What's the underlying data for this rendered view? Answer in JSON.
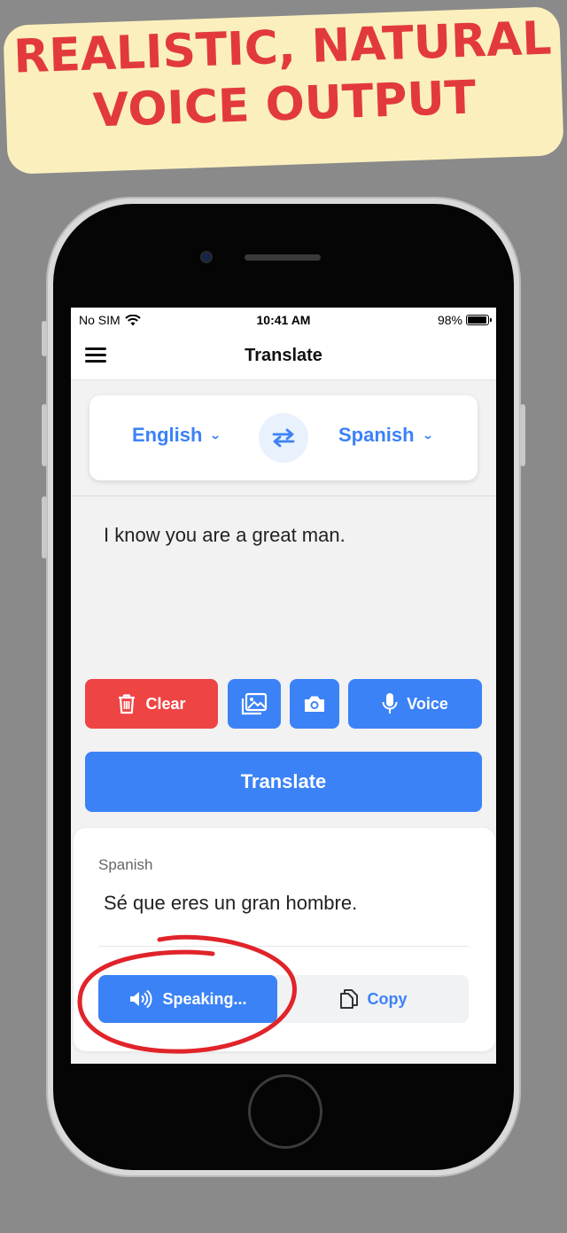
{
  "banner": {
    "line1": "Realistic, Natural",
    "line2": "Voice Output",
    "text_color": "#e23a3a",
    "background": "#fbf0bd"
  },
  "status_bar": {
    "carrier": "No SIM",
    "time": "10:41 AM",
    "battery": "98%",
    "battery_level": 0.98
  },
  "nav": {
    "title": "Translate",
    "menu_icon": "hamburger-menu-icon"
  },
  "languages": {
    "source": "English",
    "target": "Spanish",
    "swap_icon": "swap-arrows-icon"
  },
  "input": {
    "text": "I know you are a great man."
  },
  "actions": {
    "clear_label": "Clear",
    "clear_icon": "trash-icon",
    "gallery_icon": "image-gallery-icon",
    "camera_icon": "camera-icon",
    "voice_label": "Voice",
    "voice_icon": "microphone-icon"
  },
  "translate_button": "Translate",
  "result": {
    "language": "Spanish",
    "text": "Sé que eres un gran hombre.",
    "speak_label": "Speaking...",
    "speak_icon": "speaker-icon",
    "copy_label": "Copy",
    "copy_icon": "copy-icon"
  },
  "colors": {
    "primary": "#3b82f6",
    "danger": "#ef4444",
    "annotation": "#e0242a"
  }
}
